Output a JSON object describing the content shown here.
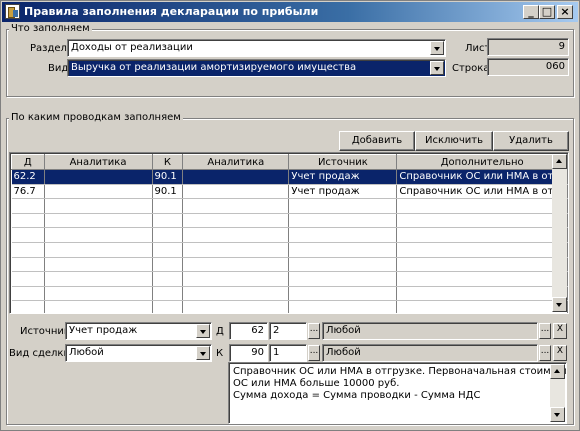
{
  "window": {
    "title": "Правила заполнения декларации по прибыли",
    "min_label": "_",
    "max_label": "□",
    "close_label": "×"
  },
  "what": {
    "group_title": "Что заполняем",
    "section_label": "Раздел",
    "section_value": "Доходы от реализации",
    "kind_label": "Вид",
    "kind_value": "Выручка от реализации амортизируемого имущества",
    "sheet_label": "Лист",
    "sheet_value": "9",
    "row_label": "Строка",
    "row_value": "060"
  },
  "postings": {
    "group_title": "По каким проводкам заполняем",
    "buttons": {
      "add": "Добавить",
      "exclude": "Исключить",
      "delete": "Удалить"
    },
    "columns": [
      "Д",
      "Аналитика",
      "К",
      "Аналитика",
      "Источник",
      "Дополнительно"
    ],
    "rows": [
      [
        "62.2",
        "",
        "90.1",
        "",
        "Учет продаж",
        "Справочник ОС или НМА в отгр"
      ],
      [
        "76.7",
        "",
        "90.1",
        "",
        "Учет продаж",
        "Справочник ОС или НМА в отгр"
      ]
    ],
    "selected_row": 0,
    "empty_rows": 8
  },
  "editor": {
    "source_label": "Источник",
    "source_value": "Учет продаж",
    "deal_label": "Вид сделки",
    "deal_value": "Любой",
    "debit_label": "Д",
    "debit_account": "62",
    "debit_level": "2",
    "debit_analytics": "Любой",
    "credit_label": "К",
    "credit_account": "90",
    "credit_level": "1",
    "credit_analytics": "Любой",
    "dots": "...",
    "clear": "X",
    "memo_lines": [
      "Справочник ОС или НМА в отгрузке. Первоначальная стоимость",
      "ОС или НМА больше 10000 руб.",
      "Сумма дохода = Сумма проводки - Сумма НДС"
    ]
  },
  "colors": {
    "title_bar": "#0a246a",
    "selection": "#0a246a",
    "face": "#d4d0c8"
  }
}
